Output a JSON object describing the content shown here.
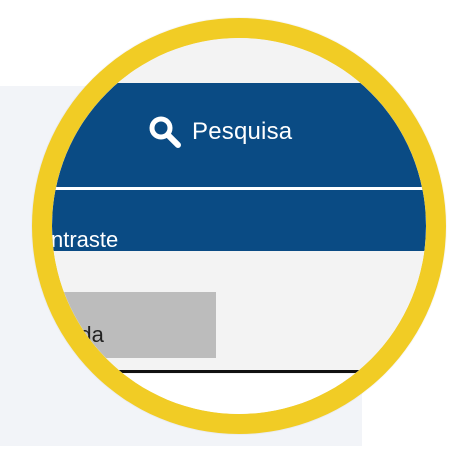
{
  "search": {
    "label": "Pesquisa",
    "icon": "search-icon"
  },
  "contrast": {
    "label": "ntraste"
  },
  "selection": {
    "label": "inada"
  },
  "colors": {
    "accent_yellow": "#f1cc25",
    "nav_blue": "#0a4b84",
    "panel_gray": "#bcbcbc",
    "background_light": "#f2f4f8"
  }
}
